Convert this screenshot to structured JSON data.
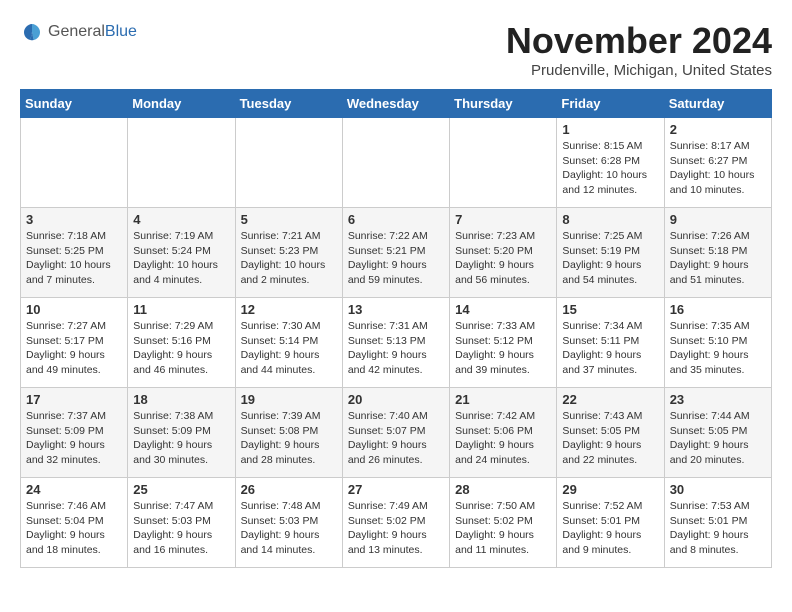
{
  "header": {
    "logo_general": "General",
    "logo_blue": "Blue",
    "month_title": "November 2024",
    "location": "Prudenville, Michigan, United States"
  },
  "calendar": {
    "weekdays": [
      "Sunday",
      "Monday",
      "Tuesday",
      "Wednesday",
      "Thursday",
      "Friday",
      "Saturday"
    ],
    "weeks": [
      [
        {
          "day": "",
          "info": ""
        },
        {
          "day": "",
          "info": ""
        },
        {
          "day": "",
          "info": ""
        },
        {
          "day": "",
          "info": ""
        },
        {
          "day": "",
          "info": ""
        },
        {
          "day": "1",
          "info": "Sunrise: 8:15 AM\nSunset: 6:28 PM\nDaylight: 10 hours and 12 minutes."
        },
        {
          "day": "2",
          "info": "Sunrise: 8:17 AM\nSunset: 6:27 PM\nDaylight: 10 hours and 10 minutes."
        }
      ],
      [
        {
          "day": "3",
          "info": "Sunrise: 7:18 AM\nSunset: 5:25 PM\nDaylight: 10 hours and 7 minutes."
        },
        {
          "day": "4",
          "info": "Sunrise: 7:19 AM\nSunset: 5:24 PM\nDaylight: 10 hours and 4 minutes."
        },
        {
          "day": "5",
          "info": "Sunrise: 7:21 AM\nSunset: 5:23 PM\nDaylight: 10 hours and 2 minutes."
        },
        {
          "day": "6",
          "info": "Sunrise: 7:22 AM\nSunset: 5:21 PM\nDaylight: 9 hours and 59 minutes."
        },
        {
          "day": "7",
          "info": "Sunrise: 7:23 AM\nSunset: 5:20 PM\nDaylight: 9 hours and 56 minutes."
        },
        {
          "day": "8",
          "info": "Sunrise: 7:25 AM\nSunset: 5:19 PM\nDaylight: 9 hours and 54 minutes."
        },
        {
          "day": "9",
          "info": "Sunrise: 7:26 AM\nSunset: 5:18 PM\nDaylight: 9 hours and 51 minutes."
        }
      ],
      [
        {
          "day": "10",
          "info": "Sunrise: 7:27 AM\nSunset: 5:17 PM\nDaylight: 9 hours and 49 minutes."
        },
        {
          "day": "11",
          "info": "Sunrise: 7:29 AM\nSunset: 5:16 PM\nDaylight: 9 hours and 46 minutes."
        },
        {
          "day": "12",
          "info": "Sunrise: 7:30 AM\nSunset: 5:14 PM\nDaylight: 9 hours and 44 minutes."
        },
        {
          "day": "13",
          "info": "Sunrise: 7:31 AM\nSunset: 5:13 PM\nDaylight: 9 hours and 42 minutes."
        },
        {
          "day": "14",
          "info": "Sunrise: 7:33 AM\nSunset: 5:12 PM\nDaylight: 9 hours and 39 minutes."
        },
        {
          "day": "15",
          "info": "Sunrise: 7:34 AM\nSunset: 5:11 PM\nDaylight: 9 hours and 37 minutes."
        },
        {
          "day": "16",
          "info": "Sunrise: 7:35 AM\nSunset: 5:10 PM\nDaylight: 9 hours and 35 minutes."
        }
      ],
      [
        {
          "day": "17",
          "info": "Sunrise: 7:37 AM\nSunset: 5:09 PM\nDaylight: 9 hours and 32 minutes."
        },
        {
          "day": "18",
          "info": "Sunrise: 7:38 AM\nSunset: 5:09 PM\nDaylight: 9 hours and 30 minutes."
        },
        {
          "day": "19",
          "info": "Sunrise: 7:39 AM\nSunset: 5:08 PM\nDaylight: 9 hours and 28 minutes."
        },
        {
          "day": "20",
          "info": "Sunrise: 7:40 AM\nSunset: 5:07 PM\nDaylight: 9 hours and 26 minutes."
        },
        {
          "day": "21",
          "info": "Sunrise: 7:42 AM\nSunset: 5:06 PM\nDaylight: 9 hours and 24 minutes."
        },
        {
          "day": "22",
          "info": "Sunrise: 7:43 AM\nSunset: 5:05 PM\nDaylight: 9 hours and 22 minutes."
        },
        {
          "day": "23",
          "info": "Sunrise: 7:44 AM\nSunset: 5:05 PM\nDaylight: 9 hours and 20 minutes."
        }
      ],
      [
        {
          "day": "24",
          "info": "Sunrise: 7:46 AM\nSunset: 5:04 PM\nDaylight: 9 hours and 18 minutes."
        },
        {
          "day": "25",
          "info": "Sunrise: 7:47 AM\nSunset: 5:03 PM\nDaylight: 9 hours and 16 minutes."
        },
        {
          "day": "26",
          "info": "Sunrise: 7:48 AM\nSunset: 5:03 PM\nDaylight: 9 hours and 14 minutes."
        },
        {
          "day": "27",
          "info": "Sunrise: 7:49 AM\nSunset: 5:02 PM\nDaylight: 9 hours and 13 minutes."
        },
        {
          "day": "28",
          "info": "Sunrise: 7:50 AM\nSunset: 5:02 PM\nDaylight: 9 hours and 11 minutes."
        },
        {
          "day": "29",
          "info": "Sunrise: 7:52 AM\nSunset: 5:01 PM\nDaylight: 9 hours and 9 minutes."
        },
        {
          "day": "30",
          "info": "Sunrise: 7:53 AM\nSunset: 5:01 PM\nDaylight: 9 hours and 8 minutes."
        }
      ]
    ]
  }
}
